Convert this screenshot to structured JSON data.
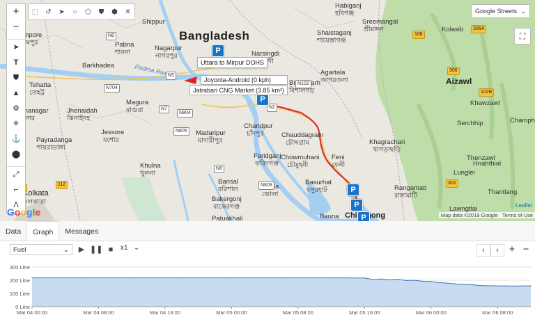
{
  "colors": {
    "water": "#aadaff",
    "land": "#e9e6df",
    "hills": "#bddba6",
    "route": "#d9262b",
    "marker": "#1a73c8",
    "fill": "#c7dcf1",
    "line": "#3b73b5"
  },
  "map": {
    "country_label": "Bangladesh",
    "layer_select": "Google Streets",
    "google_logo": "Google",
    "attribution": [
      "Map data ©2019 Google",
      "Terms of Use"
    ],
    "leaflet": "Leaflet",
    "river_label": "Padma River",
    "places": [
      {
        "name": "Bernampore",
        "local": "বহরমপুর"
      },
      {
        "name": "Pabna",
        "local": "পাবনা"
      },
      {
        "name": "Barkhadea",
        "local": ""
      },
      {
        "name": "Nagarpur",
        "local": "নাগরপুর"
      },
      {
        "name": "Shippur",
        "local": ""
      },
      {
        "name": "Narsingdi",
        "local": "নরসিংদী"
      },
      {
        "name": "Habiganj",
        "local": "হবিগঞ্জ"
      },
      {
        "name": "Shaistaganj",
        "local": "শায়েস্তাগঞ্জ"
      },
      {
        "name": "Sreemangal",
        "local": "শ্রীমঙ্গল"
      },
      {
        "name": "Kolasib",
        "local": ""
      },
      {
        "name": "Agartala",
        "local": "আগরতলা"
      },
      {
        "name": "Aizawl",
        "local": ""
      },
      {
        "name": "Tehatta",
        "local": "তেহট্ট"
      },
      {
        "name": "Magura",
        "local": "মাগুরা"
      },
      {
        "name": "Bishalgarh",
        "local": "বিশালগড়"
      },
      {
        "name": "Khawzawl",
        "local": ""
      },
      {
        "name": "Jhenaidah",
        "local": "ঝিনাইদহ"
      },
      {
        "name": "Krishnanagar",
        "local": "কৃষ্ণনগর"
      },
      {
        "name": "Chandpur",
        "local": "চাঁদপুর"
      },
      {
        "name": "Chauddagram",
        "local": "চৌদ্দগ্রাম"
      },
      {
        "name": "Serchhip",
        "local": ""
      },
      {
        "name": "Champhai",
        "local": ""
      },
      {
        "name": "Jessore",
        "local": "যশোর"
      },
      {
        "name": "Madaripur",
        "local": "মাদারীপুর"
      },
      {
        "name": "Khagrachari",
        "local": "খাগড়াছড়ি"
      },
      {
        "name": "Payradanga",
        "local": "পায়রাডাঙ্গা"
      },
      {
        "name": "Faridganj",
        "local": "ফরিদগঞ্জ"
      },
      {
        "name": "Chowmuhani",
        "local": "চৌমুহনী"
      },
      {
        "name": "Feni",
        "local": "ফেনী"
      },
      {
        "name": "Thenzawl",
        "local": ""
      },
      {
        "name": "Khulna",
        "local": "খুলনা"
      },
      {
        "name": "Hnahthial",
        "local": ""
      },
      {
        "name": "Lunglei",
        "local": ""
      },
      {
        "name": "Rangamati",
        "local": "রাঙ্গামাটি"
      },
      {
        "name": "Kolkata",
        "local": "কলকাতা"
      },
      {
        "name": "Barisal",
        "local": "বরিশাল"
      },
      {
        "name": "Bhola",
        "local": "ভোলা"
      },
      {
        "name": "Basurhat",
        "local": "বসুরহাট"
      },
      {
        "name": "Thantlang",
        "local": ""
      },
      {
        "name": "Bakergonj",
        "local": "বাকেরগঞ্জ"
      },
      {
        "name": "Lawngtlai",
        "local": ""
      },
      {
        "name": "Patuakhali",
        "local": ""
      },
      {
        "name": "Bauna",
        "local": ""
      },
      {
        "name": "Chittagong",
        "local": ""
      }
    ],
    "roads": [
      "N5",
      "N6",
      "N704",
      "N7",
      "N804",
      "N805",
      "N8",
      "N809",
      "N102",
      "N2",
      "306A",
      "108",
      "306",
      "102B",
      "302",
      "112",
      "12"
    ],
    "tooltips": {
      "route_name": "Uttara to Mirpur DOHS",
      "vehicle": "Joyonta-Android (0 kph)",
      "place": "Jatrabari CNG Market (3.85 km²)"
    }
  },
  "panel": {
    "tabs": [
      "Data",
      "Graph",
      "Messages"
    ],
    "active_tab": "Graph",
    "sensor_select": "Fuel",
    "speed_select": "x1"
  },
  "chart_data": {
    "type": "area",
    "xlabel": "",
    "ylabel": "",
    "yticks": [
      "300 Litre",
      "200 Litre",
      "100 Litre",
      "0 Litre"
    ],
    "ylim": [
      0,
      300
    ],
    "xticks": [
      "Mar 04 00:00",
      "Mar 04 08:00",
      "Mar 04 16:00",
      "Mar 05 00:00",
      "Mar 05 08:00",
      "Mar 05 16:00",
      "Mar 06 00:00",
      "Mar 06 08:00"
    ],
    "x_hours": [
      0,
      8,
      16,
      24,
      32,
      40,
      48,
      56
    ],
    "series": [
      {
        "x": [
          0,
          6,
          12,
          18,
          24,
          30,
          36,
          40,
          41,
          42,
          43,
          44,
          45,
          46,
          47,
          48,
          49,
          50,
          51,
          52,
          53,
          54,
          55,
          56,
          57,
          58,
          59,
          60
        ],
        "values": [
          218,
          218,
          218,
          218,
          218,
          218,
          218,
          217,
          205,
          210,
          203,
          207,
          198,
          200,
          192,
          190,
          182,
          178,
          172,
          168,
          165,
          160,
          158,
          157,
          157,
          156,
          157,
          157
        ]
      }
    ]
  }
}
